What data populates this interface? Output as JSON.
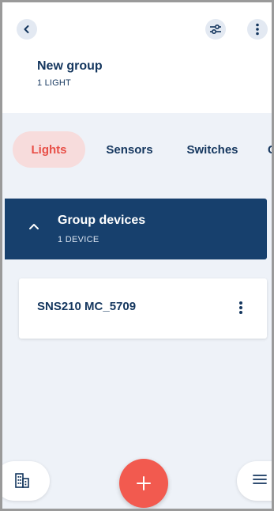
{
  "header": {
    "title": "New group",
    "subtitle": "1 LIGHT",
    "icons": {
      "back": "chevron-left-icon",
      "filter": "sliders-icon",
      "more": "vertical-dots-icon"
    }
  },
  "tabs": [
    {
      "label": "Lights",
      "active": true
    },
    {
      "label": "Sensors",
      "active": false
    },
    {
      "label": "Switches",
      "active": false
    },
    {
      "label": "C",
      "active": false
    }
  ],
  "devices_section": {
    "title": "Group devices",
    "subtitle": "1 DEVICE",
    "expanded": true
  },
  "devices": [
    {
      "name": "SNS210 MC_5709"
    }
  ],
  "bottom_bar": {
    "left_icon": "building-icon",
    "center_icon": "plus-icon",
    "right_icon": "menu-icon"
  },
  "colors": {
    "primary": "#14365e",
    "banner": "#17406d",
    "accent": "#f25a4f",
    "active_tab_bg": "#f7dcdc",
    "background": "#eef2f8"
  }
}
